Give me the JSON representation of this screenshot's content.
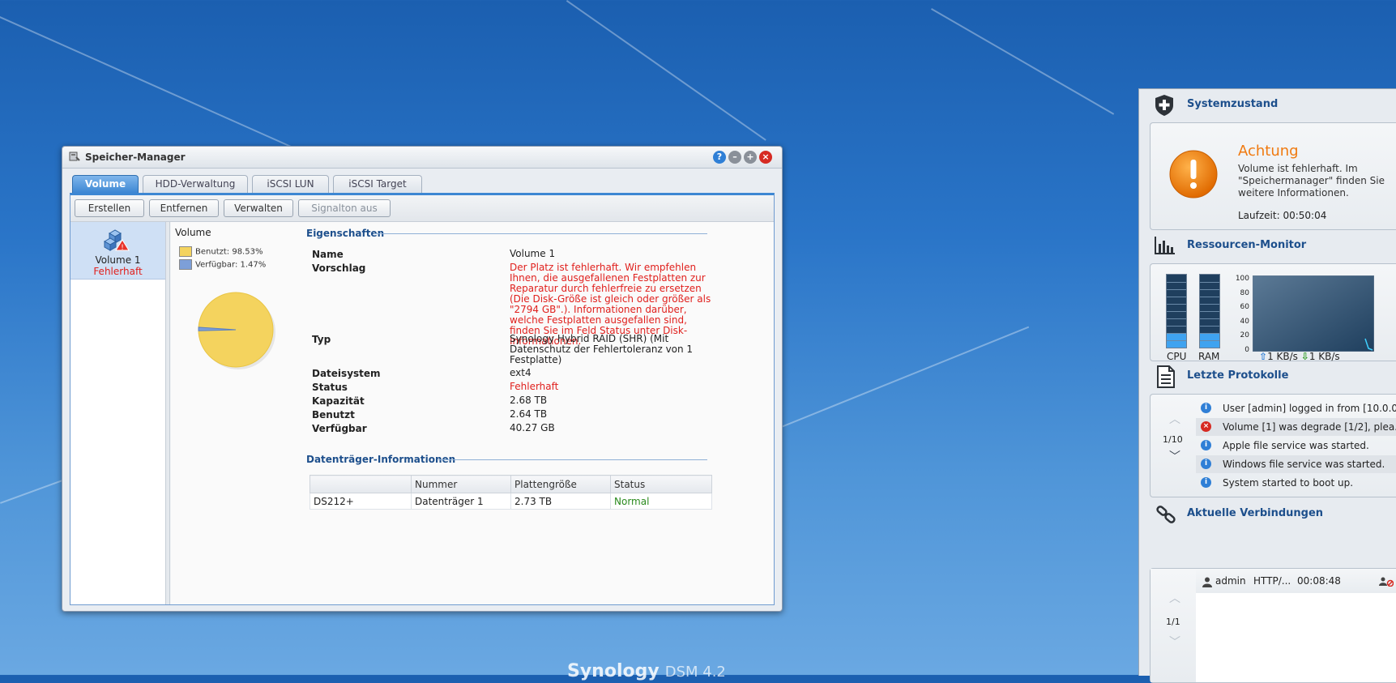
{
  "desktop": {
    "brand": "Synology",
    "brand_version": "DSM 4.2"
  },
  "window": {
    "title": "Speicher-Manager",
    "tabs": [
      {
        "label": "Volume",
        "active": true
      },
      {
        "label": "HDD-Verwaltung",
        "active": false
      },
      {
        "label": "iSCSI LUN",
        "active": false
      },
      {
        "label": "iSCSI Target",
        "active": false
      }
    ],
    "toolbar": {
      "create": "Erstellen",
      "remove": "Entfernen",
      "manage": "Verwalten",
      "mute": "Signalton aus"
    },
    "volume_list": [
      {
        "name": "Volume 1",
        "status": "Fehlerhaft"
      }
    ],
    "panel_heading": "Volume",
    "usage": {
      "used_label": "Benutzt: 98.53%",
      "free_label": "Verfügbar: 1.47%",
      "used_percent": 98.53,
      "free_percent": 1.47,
      "used_color": "#f4d35e",
      "free_color": "#7d9fd8"
    },
    "properties": {
      "title": "Eigenschaften",
      "rows": [
        {
          "label": "Name",
          "value": "Volume 1"
        },
        {
          "label": "Vorschlag",
          "value": "Der Platz ist fehlerhaft. Wir empfehlen Ihnen, die ausgefallenen Festplatten zur Reparatur durch fehlerfreie zu ersetzen (Die Disk-Größe ist gleich oder größer als \"2794 GB\".). Informationen darüber, welche Festplatten ausgefallen sind, finden Sie im Feld Status unter Disk-Informationen."
        },
        {
          "label": "Typ",
          "value": "Synology Hybrid RAID (SHR) (Mit Datenschutz der Fehlertoleranz von 1 Festplatte)"
        },
        {
          "label": "Dateisystem",
          "value": "ext4"
        },
        {
          "label": "Status",
          "value": "Fehlerhaft"
        },
        {
          "label": "Kapazität",
          "value": "2.68 TB"
        },
        {
          "label": "Benutzt",
          "value": "2.64 TB"
        },
        {
          "label": "Verfügbar",
          "value": "40.27 GB"
        }
      ]
    },
    "disk_info": {
      "title": "Datenträger-Informationen",
      "headers": [
        "",
        "Nummer",
        "Plattengröße",
        "Status"
      ],
      "rows": [
        [
          "DS212+",
          "Datenträger 1",
          "2.73 TB",
          "Normal"
        ]
      ]
    }
  },
  "widgets": {
    "health": {
      "title": "Systemzustand",
      "status_title": "Achtung",
      "message": "Volume ist fehlerhaft. Im \"Speichermanager\" finden Sie weitere Informationen.",
      "uptime": "Laufzeit: 00:50:04"
    },
    "resources": {
      "title": "Ressourcen-Monitor",
      "cpu_label": "CPU",
      "ram_label": "RAM",
      "cpu_percent": 20,
      "ram_percent": 20,
      "y_ticks": [
        "100",
        "80",
        "60",
        "40",
        "20",
        "0"
      ],
      "upload": "1 KB/s",
      "download": "1 KB/s"
    },
    "logs": {
      "title": "Letzte Protokolle",
      "page": "1/10",
      "entries": [
        {
          "type": "info",
          "text": "User [admin] logged in from [10.0.0..."
        },
        {
          "type": "error",
          "text": "Volume [1] was degrade [1/2], plea..."
        },
        {
          "type": "info",
          "text": "Apple file service was started."
        },
        {
          "type": "info",
          "text": "Windows file service was started."
        },
        {
          "type": "info",
          "text": "System started to boot up."
        }
      ]
    },
    "connections": {
      "title": "Aktuelle Verbindungen",
      "page": "1/1",
      "rows": [
        {
          "user": "admin",
          "protocol": "HTTP/...",
          "time": "00:08:48"
        }
      ]
    }
  }
}
